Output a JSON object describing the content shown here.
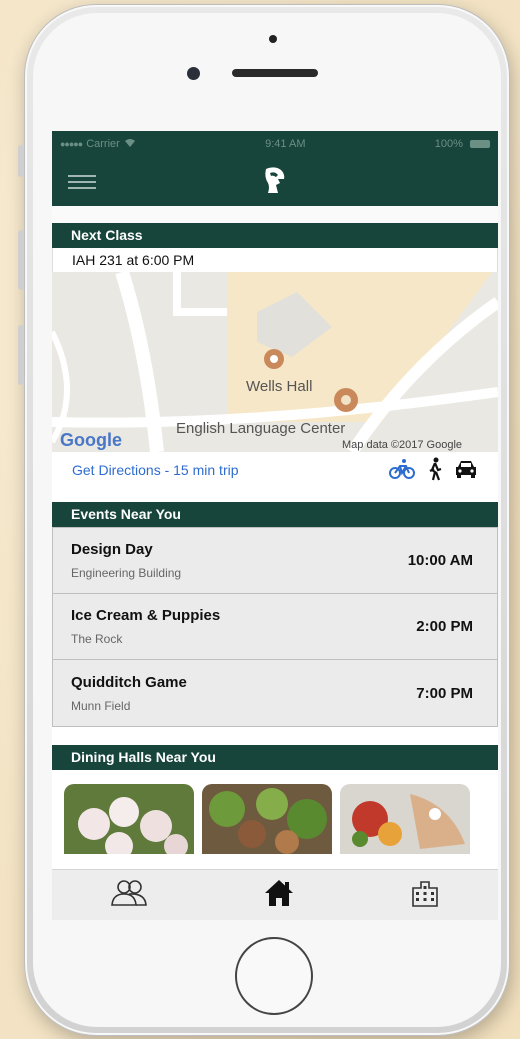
{
  "status_bar": {
    "carrier": "Carrier",
    "time": "9:41 AM",
    "battery": "100%"
  },
  "next_class": {
    "header": "Next Class",
    "value": "IAH 231 at 6:00 PM"
  },
  "map": {
    "labels": {
      "wells_hall": "Wells Hall",
      "english_center": "English Language Center",
      "google": "Google",
      "map_data": "Map data ©2017 Google"
    }
  },
  "directions": {
    "label": "Get Directions - 15 min trip",
    "icons": [
      "bicycle-icon",
      "walk-icon",
      "car-icon"
    ]
  },
  "events": {
    "header": "Events Near You",
    "items": [
      {
        "title": "Design Day",
        "location": "Engineering Building",
        "time": "10:00 AM"
      },
      {
        "title": "Ice Cream & Puppies",
        "location": "The Rock",
        "time": "2:00 PM"
      },
      {
        "title": "Quidditch Game",
        "location": "Munn Field",
        "time": "7:00 PM"
      }
    ]
  },
  "dining": {
    "header": "Dining Halls Near You"
  },
  "tabs": [
    "people-icon",
    "home-icon",
    "building-icon"
  ],
  "colors": {
    "brand_green": "#18453b",
    "link_blue": "#2e6dcf"
  }
}
